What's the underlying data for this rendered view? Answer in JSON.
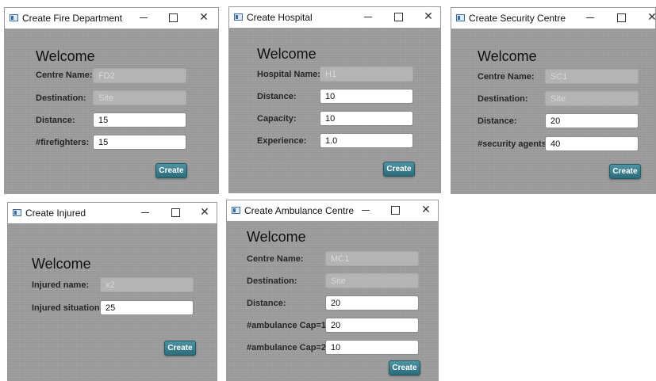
{
  "controls": {
    "minimize_icon": "minimize-icon",
    "maximize_icon": "maximize-icon",
    "close_symbol": "✕"
  },
  "windows": {
    "fire": {
      "title": "Create Fire Department",
      "welcome": "Welcome",
      "labels": [
        "Centre Name:",
        "Destination:",
        "Distance:",
        "#firefighters:"
      ],
      "values": [
        "FD2",
        "Site",
        "15",
        "15"
      ],
      "button": "Create"
    },
    "hospital": {
      "title": "Create Hospital",
      "welcome": "Welcome",
      "labels": [
        "Hospital Name:",
        "Distance:",
        "Capacity:",
        "Experience:"
      ],
      "values": [
        "H1",
        "10",
        "10",
        "1.0"
      ],
      "button": "Create"
    },
    "security": {
      "title": "Create Security Centre",
      "welcome": "Welcome",
      "labels": [
        "Centre Name:",
        "Destination:",
        "Distance:",
        "#security agents:"
      ],
      "values": [
        "SC1",
        "Site",
        "20",
        "40"
      ],
      "button": "Create"
    },
    "injured": {
      "title": "Create Injured",
      "welcome": "Welcome",
      "labels": [
        "Injured name:",
        "Injured situation:"
      ],
      "values": [
        "x2",
        "25"
      ],
      "button": "Create"
    },
    "ambulance": {
      "title": "Create Ambulance Centre",
      "welcome": "Welcome",
      "labels": [
        "Centre Name:",
        "Destination:",
        "Distance:",
        "#ambulance Cap=1:",
        "#ambulance Cap=2:"
      ],
      "values": [
        "MC1",
        "Site",
        "20",
        "20",
        "10"
      ],
      "button": "Create"
    }
  }
}
